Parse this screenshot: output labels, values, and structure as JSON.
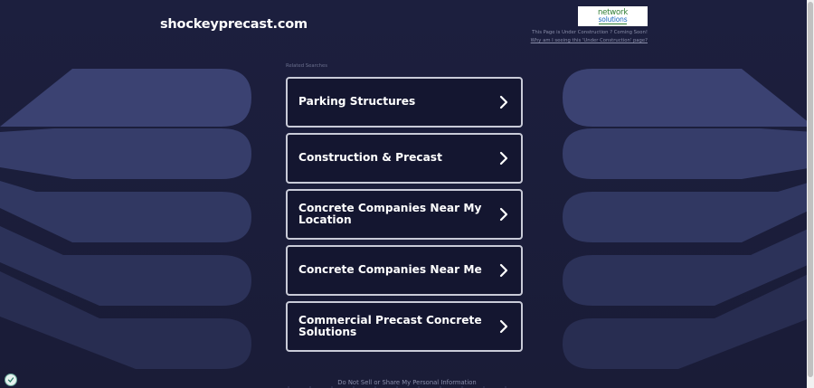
{
  "site": {
    "domain": "shockeyprecast.com"
  },
  "header": {
    "logo_line1": "network",
    "logo_line2": "solutions",
    "under_construction": "This Page is Under Construction ? Coming Soon!",
    "why_link": "Why am I seeing this 'Under Construction' page?"
  },
  "related": {
    "label": "Related Searches",
    "items": [
      {
        "label": "Parking Structures"
      },
      {
        "label": "Construction & Precast"
      },
      {
        "label": "Concrete Companies Near My Location"
      },
      {
        "label": "Concrete Companies Near Me"
      },
      {
        "label": "Commercial Precast Concrete Solutions"
      }
    ]
  },
  "footer": {
    "privacy_link": "Do Not Sell or Share My Personal Information"
  },
  "colors": {
    "background": "#1c1f3e",
    "card_border": "#c9cbd8",
    "card_background": "#141630",
    "text": "#ffffff"
  },
  "icons": {
    "chevron": "chevron-right-icon",
    "privacy": "privacy-badge-icon"
  }
}
